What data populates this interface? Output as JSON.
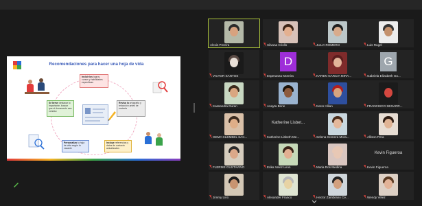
{
  "slide": {
    "title": "Recomendaciones para hacer una hoja de vida",
    "boxes": [
      {
        "id": "top",
        "bold": "Incluir los",
        "text": "logros, cursos y habilidades específicas"
      },
      {
        "id": "left",
        "bold": "Sé breve",
        "text": "destacar lo importante, buscar que el documento sea conciso"
      },
      {
        "id": "right",
        "bold": "Revisa la",
        "text": "ortografía y redacción antes de enviarla"
      },
      {
        "id": "bottomleft",
        "bold": "Personaliza",
        "text": "tu hoja de vida según la vacante"
      },
      {
        "id": "bottomright",
        "bold": "Incluye",
        "text": "referencias y datos de contacto actualizados"
      }
    ]
  },
  "colors": {
    "accent_active": "#a8c23a",
    "muted_red": "#e0443e",
    "tile_bg": "#232323"
  },
  "participants": [
    {
      "name": "Alexis Pereira",
      "muted": false,
      "type": "photo",
      "bg": "#b4b9a8",
      "skin": "#d7a27f",
      "hair": "#2a2a2a",
      "active": true
    },
    {
      "name": "Silvana Criollo",
      "muted": true,
      "type": "photo",
      "bg": "#d7c1b8",
      "skin": "#e3b090",
      "hair": "#3b2416"
    },
    {
      "name": "JULIA ROMERO",
      "muted": true,
      "type": "photo",
      "bg": "#bcc7c9",
      "skin": "#d8ab8c",
      "hair": "#1e1e1e"
    },
    {
      "name": "Luis Rugel",
      "muted": true,
      "type": "photo",
      "bg": "#ececec",
      "skin": "#c4916d",
      "hair": "#333333"
    },
    {
      "name": "VICTOR SANTOS",
      "muted": true,
      "type": "photo",
      "bg": "#1a1a1a",
      "skin": "#e9e0d8",
      "hair": "#5a4a44"
    },
    {
      "name": "Esperanza Moreira",
      "muted": true,
      "type": "letter",
      "letter": "D",
      "bg": "#9e2ed9"
    },
    {
      "name": "KAREN GARCIA MIRA...",
      "muted": true,
      "type": "photo",
      "bg": "#7f2b2b",
      "skin": "#e2b499",
      "hair": "#5a1d1d"
    },
    {
      "name": "Gabriela Elizabeth Go...",
      "muted": true,
      "type": "letter",
      "letter": "G",
      "bg": "#9ea6ad"
    },
    {
      "name": "Kassandra Duran",
      "muted": true,
      "type": "photo",
      "bg": "#c8d8c2",
      "skin": "#d9a681",
      "hair": "#3a2a1c"
    },
    {
      "name": "Anayta Bone",
      "muted": true,
      "type": "photo",
      "bg": "#9ab3cf",
      "skin": "#8d5b3e",
      "hair": "#1c1208"
    },
    {
      "name": "Nerer Allian",
      "muted": true,
      "type": "photo",
      "bg": "#2e4f9e",
      "skin": "#d6a47f",
      "hair": "#b21f1f"
    },
    {
      "name": "FRANCISCO SEGARR...",
      "muted": true,
      "type": "photo",
      "bg": "#1b1b1b",
      "skin": "#d4473f",
      "hair": "#1b1b1b"
    },
    {
      "name": "GEMA CLEMBEL SAC...",
      "muted": true,
      "type": "photo",
      "bg": "#d9c0a8",
      "skin": "#dfae88",
      "hair": "#3a2a1e"
    },
    {
      "name": "Katherine Lisbeth Me...",
      "muted": true,
      "type": "text",
      "label": "Katherine Lisbet..."
    },
    {
      "name": "Selena Gomera Mora...",
      "muted": true,
      "type": "photo",
      "bg": "#c9d7de",
      "skin": "#e4b89b",
      "hair": "#4a2c1a"
    },
    {
      "name": "Allison Pera",
      "muted": true,
      "type": "photo",
      "bg": "#e7ddd3",
      "skin": "#e0b495",
      "hair": "#2e1c12"
    },
    {
      "name": "FLERME GUSTAVINO",
      "muted": true,
      "type": "photo",
      "bg": "#d6cdbe",
      "skin": "#dba889",
      "hair": "#2a2a2a"
    },
    {
      "name": "Erika Velez Leon",
      "muted": true,
      "type": "photo",
      "bg": "#c6d9b8",
      "skin": "#e2b092",
      "hair": "#3a2418"
    },
    {
      "name": "Maria Ros Medina",
      "muted": true,
      "type": "photo",
      "bg": "#d9c6c0",
      "skin": "#e8c8b5",
      "hair": "#e8c8b5"
    },
    {
      "name": "Kevin Figueroa",
      "muted": true,
      "type": "text",
      "label": "Kevin Figueroa"
    },
    {
      "name": "Jimmy Lino",
      "muted": true,
      "type": "photo",
      "bg": "#d4c8b6",
      "skin": "#c89471",
      "hair": "#1c1c1c"
    },
    {
      "name": "Alexander Franco",
      "muted": true,
      "type": "photo",
      "bg": "#dfe5d2",
      "skin": "#e7d3a4",
      "hair": "#b8b8b8"
    },
    {
      "name": "Hector Zambrano Ce...",
      "muted": true,
      "type": "photo",
      "bg": "#cfd6db",
      "skin": "#d2a07e",
      "hair": "#222222"
    },
    {
      "name": "Wendy Velez",
      "muted": true,
      "type": "photo",
      "bg": "#ddd0c4",
      "skin": "#e2b397",
      "hair": "#5a3a22"
    }
  ]
}
